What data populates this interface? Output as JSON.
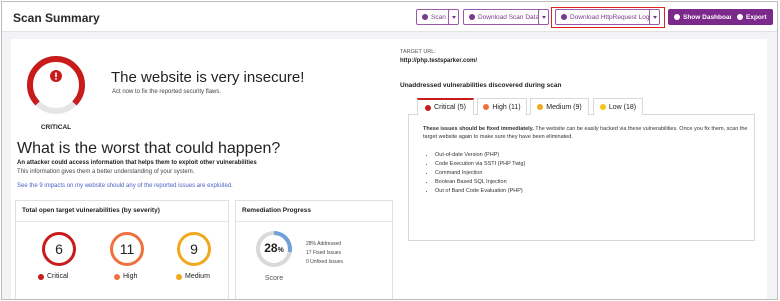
{
  "page": {
    "title": "Scan Summary"
  },
  "toolbar": {
    "scan_label": "Scan",
    "download_data_label": "Download Scan Data",
    "download_logs_label": "Download HttpRequest Logs",
    "dashboard_label": "Show Dashboard",
    "export_label": "Export"
  },
  "summary": {
    "severity_badge": "CRITICAL",
    "headline": "The website is very insecure!",
    "subtext": "Act now to fix the reported security flaws."
  },
  "worst": {
    "heading": "What is the worst that could happen?",
    "line1": "An attacker could access information that helps them to exploit other vulnerabilities",
    "line2": "This information gives them a better understanding of your system.",
    "link": "See the 9 impacts on my website should any of the reported issues are exploited."
  },
  "totals": {
    "title": "Total open target vulnerabilities (by severity)",
    "items": [
      {
        "label": "Critical",
        "count": "6",
        "color": "#c81b1b"
      },
      {
        "label": "High",
        "count": "11",
        "color": "#f07040"
      },
      {
        "label": "Medium",
        "count": "9",
        "color": "#f0a81c"
      }
    ]
  },
  "remediation": {
    "title": "Remediation Progress",
    "score_value": "28",
    "score_unit": "%",
    "score_label": "Score",
    "progress_fraction": 0.28,
    "stats": [
      "28% Addressed",
      "17 Fixed Issues",
      "0 Unfixed Issues"
    ]
  },
  "target": {
    "label": "TARGET URL:",
    "url": "http://php.testsparker.com/"
  },
  "vulns": {
    "heading": "Unaddressed vulnerabilities discovered during scan",
    "tabs": [
      {
        "label": "Critical (5)",
        "color": "#c81b1b"
      },
      {
        "label": "High (11)",
        "color": "#f07040"
      },
      {
        "label": "Medium (9)",
        "color": "#f0a81c"
      },
      {
        "label": "Low (18)",
        "color": "#f5c518"
      }
    ],
    "panel_lead": "These issues should be fixed immediately.",
    "panel_text": " The website can be easily hacked via these vulnerabilities. Once you fix them, scan the target website again to make sure they have been eliminated.",
    "issues": [
      "Out-of-date Version (PHP)",
      "Code Execution via SSTI (PHP Twig)",
      "Command Injection",
      "Boolean Based SQL Injection",
      "Out of Band Code Evaluation (PHP)"
    ]
  },
  "colors": {
    "brand": "#7b2a8c",
    "critical": "#c81b1b",
    "highlight": "#d9261c"
  }
}
